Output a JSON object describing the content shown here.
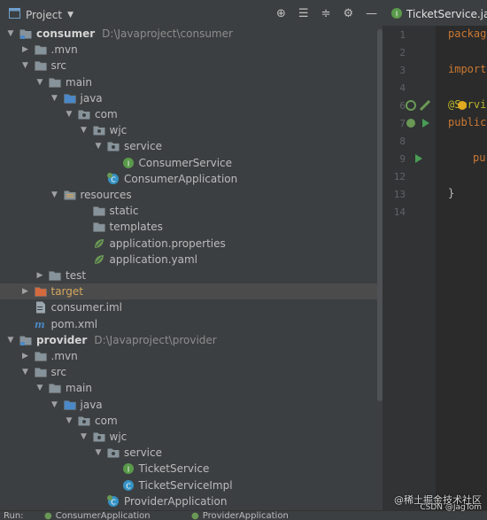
{
  "toolbar": {
    "title": "Project",
    "editor_tab": "TicketService.java"
  },
  "tree": [
    {
      "label": "consumer",
      "path": "D:\\Javaproject\\consumer",
      "type": "module",
      "arrow": "down",
      "indent": 0,
      "bold": true
    },
    {
      "label": ".mvn",
      "type": "folder",
      "arrow": "right",
      "indent": 1
    },
    {
      "label": "src",
      "type": "folder",
      "arrow": "down",
      "indent": 1
    },
    {
      "label": "main",
      "type": "folder",
      "arrow": "down",
      "indent": 2
    },
    {
      "label": "java",
      "type": "src-folder",
      "arrow": "down",
      "indent": 3
    },
    {
      "label": "com",
      "type": "package",
      "arrow": "down",
      "indent": 4
    },
    {
      "label": "wjc",
      "type": "package",
      "arrow": "down",
      "indent": 5
    },
    {
      "label": "service",
      "type": "package",
      "arrow": "down",
      "indent": 6
    },
    {
      "label": "ConsumerService",
      "type": "interface",
      "arrow": "none",
      "indent": 7
    },
    {
      "label": "ConsumerApplication",
      "type": "spring-class",
      "arrow": "none",
      "indent": 6
    },
    {
      "label": "resources",
      "type": "res-folder",
      "arrow": "down",
      "indent": 3
    },
    {
      "label": "static",
      "type": "folder",
      "arrow": "none",
      "indent": 5
    },
    {
      "label": "templates",
      "type": "folder",
      "arrow": "none",
      "indent": 5
    },
    {
      "label": "application.properties",
      "type": "spring-file",
      "arrow": "none",
      "indent": 5
    },
    {
      "label": "application.yaml",
      "type": "spring-file",
      "arrow": "none",
      "indent": 5
    },
    {
      "label": "test",
      "type": "folder",
      "arrow": "right",
      "indent": 2
    },
    {
      "label": "target",
      "type": "excluded",
      "arrow": "right",
      "indent": 1,
      "selected": true,
      "orange": true
    },
    {
      "label": "consumer.iml",
      "type": "iml",
      "arrow": "none",
      "indent": 1
    },
    {
      "label": "pom.xml",
      "type": "maven",
      "arrow": "none",
      "indent": 1
    },
    {
      "label": "provider",
      "path": "D:\\Javaproject\\provider",
      "type": "module",
      "arrow": "down",
      "indent": 0,
      "bold": true
    },
    {
      "label": ".mvn",
      "type": "folder",
      "arrow": "right",
      "indent": 1
    },
    {
      "label": "src",
      "type": "folder",
      "arrow": "down",
      "indent": 1
    },
    {
      "label": "main",
      "type": "folder",
      "arrow": "down",
      "indent": 2
    },
    {
      "label": "java",
      "type": "src-folder",
      "arrow": "down",
      "indent": 3
    },
    {
      "label": "com",
      "type": "package",
      "arrow": "down",
      "indent": 4
    },
    {
      "label": "wjc",
      "type": "package",
      "arrow": "down",
      "indent": 5
    },
    {
      "label": "service",
      "type": "package",
      "arrow": "down",
      "indent": 6
    },
    {
      "label": "TicketService",
      "type": "interface",
      "arrow": "none",
      "indent": 7
    },
    {
      "label": "TicketServiceImpl",
      "type": "class",
      "arrow": "none",
      "indent": 7
    },
    {
      "label": "ProviderApplication",
      "type": "spring-class",
      "arrow": "none",
      "indent": 6
    }
  ],
  "editor": {
    "lines": [
      {
        "num": "1",
        "code": "package"
      },
      {
        "num": "2",
        "code": ""
      },
      {
        "num": "3",
        "code": "import"
      },
      {
        "num": "4",
        "code": ""
      },
      {
        "num": "6",
        "code": "@Servi"
      },
      {
        "num": "7",
        "code": "public"
      },
      {
        "num": "8",
        "code": ""
      },
      {
        "num": "9",
        "code": "pu"
      },
      {
        "num": "12",
        "code": ""
      },
      {
        "num": "13",
        "code": "}"
      },
      {
        "num": "14",
        "code": ""
      }
    ]
  },
  "bottom_bar": {
    "run_label": "Run:",
    "run_tabs": [
      "ConsumerApplication",
      "ProviderApplication"
    ]
  },
  "watermark": {
    "line1": "@稀土掘金技术社区",
    "line2": "CSDN @JagTom"
  },
  "colors": {
    "tree_bg": "#3c3f41",
    "editor_bg": "#2b2b2b",
    "keyword": "#cc7832",
    "selection": "#4b4b4b"
  }
}
